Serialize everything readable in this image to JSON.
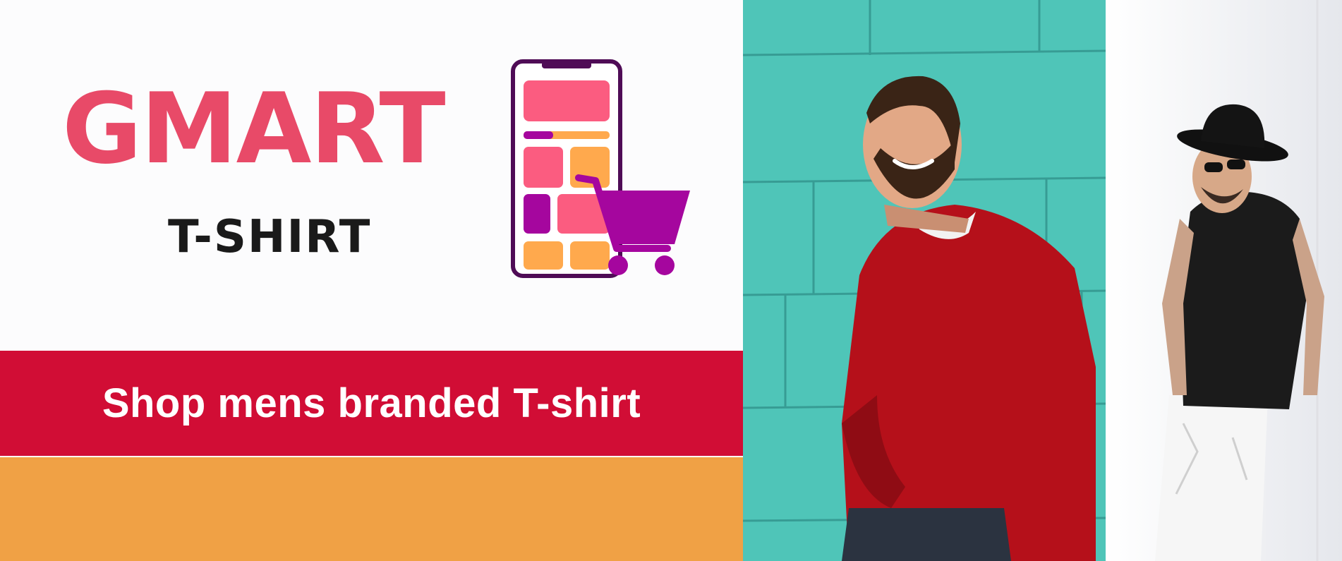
{
  "brand": {
    "name": "GMART",
    "subtitle": "T-SHIRT"
  },
  "tagline": "Shop mens branded T-shirt",
  "icons": {
    "logo": "phone-shopping-cart-icon"
  },
  "colors": {
    "brand_pink": "#e84a68",
    "subtitle_dark": "#1a1a1a",
    "tagline_band": "#d10d35",
    "orange_band": "#f0a145",
    "tile_pink": "#fb5c80",
    "tile_orange": "#ffa94d",
    "tile_purple": "#a5069e",
    "phone_frame": "#4f0c56",
    "teal_wall": "#4fc5b8",
    "red_sweater": "#b5101a"
  }
}
